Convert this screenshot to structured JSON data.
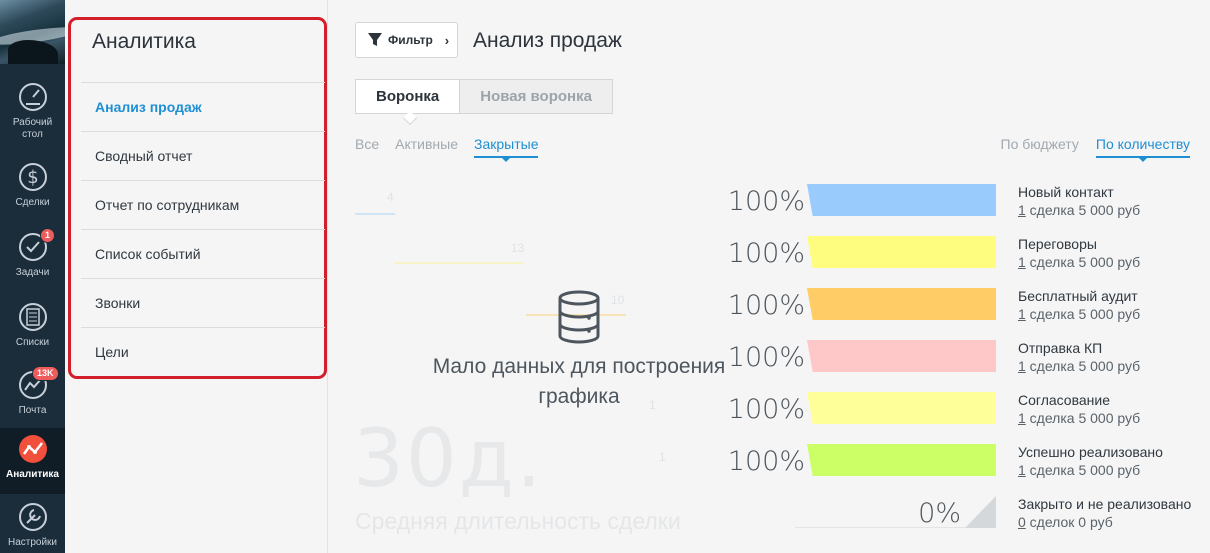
{
  "nav": {
    "items": [
      {
        "label": "Рабочий стол",
        "line1": "Рабочий",
        "line2": "стол",
        "icon": "dashboard-icon"
      },
      {
        "label": "Сделки",
        "icon": "dollar-icon"
      },
      {
        "label": "Задачи",
        "icon": "checkmark-icon",
        "badge": "1"
      },
      {
        "label": "Списки",
        "icon": "list-icon"
      },
      {
        "label": "Почта",
        "icon": "mail-icon",
        "badge": "13K"
      },
      {
        "label": "Аналитика",
        "icon": "analytics-icon"
      },
      {
        "label": "Настройки",
        "icon": "wrench-icon"
      }
    ]
  },
  "submenu": {
    "title": "Аналитика",
    "items": [
      {
        "label": "Анализ продаж",
        "active": true
      },
      {
        "label": "Сводный отчет"
      },
      {
        "label": "Отчет по сотрудникам"
      },
      {
        "label": "Список событий"
      },
      {
        "label": "Звонки"
      },
      {
        "label": "Цели"
      }
    ]
  },
  "main": {
    "filter_label": "Фильтр",
    "title": "Анализ продаж",
    "tabs": [
      {
        "label": "Воронка",
        "active": true
      },
      {
        "label": "Новая воронка"
      }
    ],
    "status_filters": [
      "Все",
      "Активные",
      "Закрытые"
    ],
    "measure_filters": [
      "По бюджету",
      "По количеству"
    ],
    "empty_message": "Мало данных для построения графика",
    "avg_duration_value": "30д.",
    "avg_duration_caption": "Средняя длительность сделки",
    "ghost_numbers": [
      "4",
      "13",
      "10",
      "1",
      "1"
    ]
  },
  "funnel": [
    {
      "percent": "100%",
      "name": "Новый контакт",
      "deal_count": "1",
      "deal_rest": " сделка 5 000 руб",
      "color": "#99ccfd"
    },
    {
      "percent": "100%",
      "name": "Переговоры",
      "deal_count": "1",
      "deal_rest": " сделка 5 000 руб",
      "color": "#fffd7f"
    },
    {
      "percent": "100%",
      "name": "Бесплатный аудит",
      "deal_count": "1",
      "deal_rest": " сделка 5 000 руб",
      "color": "#ffcc66"
    },
    {
      "percent": "100%",
      "name": "Отправка КП",
      "deal_count": "1",
      "deal_rest": " сделка 5 000 руб",
      "color": "#ffc8c8"
    },
    {
      "percent": "100%",
      "name": "Согласование",
      "deal_count": "1",
      "deal_rest": " сделка 5 000 руб",
      "color": "#ffff99"
    },
    {
      "percent": "100%",
      "name": "Успешно реализовано",
      "deal_count": "1",
      "deal_rest": " сделка 5 000 руб",
      "color": "#ccff66"
    },
    {
      "percent": "0%",
      "name": "Закрыто и не реализовано",
      "deal_count": "0",
      "deal_rest": " сделок 0 руб",
      "color": "#d5d8db"
    }
  ]
}
